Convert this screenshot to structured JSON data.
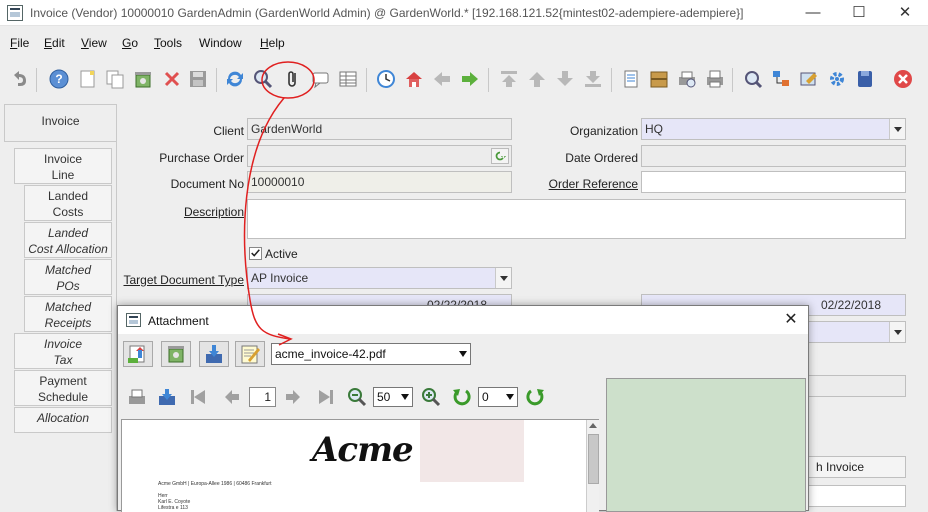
{
  "window": {
    "title": "Invoice (Vendor)  10000010  GardenAdmin (GardenWorld Admin) @ GardenWorld.* [192.168.121.52{mintest02-adempiere-adempiere}]",
    "minimize": "—",
    "maximize": "☐",
    "close": "✕"
  },
  "menu": {
    "file": {
      "key": "F",
      "rest": "ile"
    },
    "edit": {
      "key": "E",
      "rest": "dit"
    },
    "view": {
      "key": "V",
      "rest": "iew"
    },
    "go": {
      "key": "G",
      "rest": "o"
    },
    "tools": {
      "key": "T",
      "rest": "ools"
    },
    "window": "Window",
    "help": {
      "key": "H",
      "rest": "elp"
    }
  },
  "toolbar": {
    "icons": [
      "undo-icon",
      "help-icon",
      "new-record-icon",
      "copy-record-icon",
      "delete-icon",
      "delete-selection-icon",
      "save-icon",
      "refresh-icon",
      "find-icon",
      "attachment-icon",
      "chat-icon",
      "grid-toggle-icon",
      "history-icon",
      "home-icon",
      "previous-arrow-icon",
      "next-arrow-icon",
      "first-record-icon",
      "previous-record-icon",
      "next-record-icon",
      "last-record-icon",
      "report-icon",
      "archive-icon",
      "print-preview-icon",
      "print-icon",
      "zoom-across-icon",
      "active-workflows-icon",
      "requests-icon",
      "product-info-icon",
      "process-icon",
      "lock-icon",
      "exit-icon"
    ]
  },
  "tabs": [
    {
      "label": "Invoice",
      "active": true,
      "italic": false
    },
    {
      "label": "Invoice\nLine",
      "active": false,
      "italic": false
    },
    {
      "label": "Landed\nCosts",
      "active": false,
      "italic": false
    },
    {
      "label": "Landed\nCost Allocation",
      "active": false,
      "italic": true
    },
    {
      "label": "Matched\nPOs",
      "active": false,
      "italic": true
    },
    {
      "label": "Matched\nReceipts",
      "active": false,
      "italic": true
    },
    {
      "label": "Invoice\nTax",
      "active": false,
      "italic": true
    },
    {
      "label": "Payment\nSchedule",
      "active": false,
      "italic": false
    },
    {
      "label": "Allocation",
      "active": false,
      "italic": true
    }
  ],
  "form": {
    "client_label": "Client",
    "client_value": "GardenWorld",
    "organization_label": "Organization",
    "organization_value": "HQ",
    "purchase_order_label": "Purchase Order",
    "purchase_order_value": "",
    "date_ordered_label": "Date Ordered",
    "date_ordered_value": "",
    "document_no_label": "Document No",
    "document_no_value": "10000010",
    "order_reference_label": "Order Reference",
    "order_reference_value": "",
    "description_label": "Description",
    "description_value": "",
    "active_label": "Active",
    "active_checked": true,
    "target_doc_type_label": "Target Document Type",
    "target_doc_type_value": "AP Invoice",
    "date_invoiced_value": "02/22/2018",
    "date_account_value": "02/22/2018",
    "button_partial": "h Invoice"
  },
  "attachment": {
    "title": "Attachment",
    "close": "✕",
    "selected_file": "acme_invoice-42.pdf",
    "page_number": "1",
    "zoom_value": "50",
    "rotation_value": "0",
    "pdf": {
      "logo": "Acme",
      "sender_line": "Acme GmbH | Europa-Allee 1986 | 60486 Frankfurt",
      "address_lines": [
        "Herr",
        "Karl E. Coyote",
        "Lifestra  e 113"
      ]
    }
  },
  "colors": {
    "accent_red": "#e02020",
    "mandatory_bg": "#e6e6f8",
    "right_panel": "#cde0cb"
  }
}
